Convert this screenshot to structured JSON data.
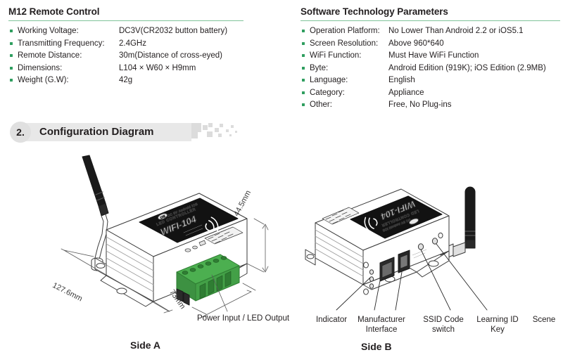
{
  "remote": {
    "title": "M12 Remote Control",
    "rows": [
      {
        "label": "Working Voltage:",
        "value": "DC3V(CR2032 button battery)"
      },
      {
        "label": "Transmitting Frequency:",
        "value": "2.4GHz"
      },
      {
        "label": "Remote Distance:",
        "value": "30m(Distance of cross-eyed)"
      },
      {
        "label": "Dimensions:",
        "value": "L104 × W60 × H9mm"
      },
      {
        "label": "Weight (G.W):",
        "value": "42g"
      }
    ]
  },
  "software": {
    "title": "Software Technology Parameters",
    "rows": [
      {
        "label": "Operation Platform:",
        "value": "No Lower Than Android 2.2 or iOS5.1"
      },
      {
        "label": "Screen Resolution:",
        "value": "Above 960*640"
      },
      {
        "label": "WiFi Function:",
        "value": "Must Have WiFi Function"
      },
      {
        "label": "Byte:",
        "value": "Android Edition (919K); iOS Edition (2.9MB)"
      },
      {
        "label": "Language:",
        "value": "English"
      },
      {
        "label": "Category:",
        "value": "Appliance"
      },
      {
        "label": "Other:",
        "value": "Free, No Plug-ins"
      }
    ]
  },
  "section": {
    "number": "2.",
    "title": "Configuration Diagram"
  },
  "side_a": {
    "caption": "Side A",
    "device_label_line1": "LED CONTROLLER",
    "device_label_line2": "WIFI-104",
    "device_label_sub": "DC 5V  Android  iOS",
    "dimensions": {
      "length": "127.6mm",
      "height": "44.5mm",
      "depth": "73mm"
    },
    "port_label": "Power Input / LED Output"
  },
  "side_b": {
    "caption": "Side B",
    "device_label_line1": "LED CONTROLLER",
    "device_label_line2": "WIFI-104",
    "callouts": [
      {
        "text": "Indicator"
      },
      {
        "text": "Manufacturer\nInterface"
      },
      {
        "text": "SSID Code\nswitch"
      },
      {
        "text": "Learning ID\nKey"
      },
      {
        "text": "Scene"
      }
    ]
  },
  "colors": {
    "accent_rule": "#7fc49a",
    "bullet": "#2f9e5f",
    "banner_bar": "#e8e8e8",
    "banner_circle": "#e0e0e0",
    "terminal_green": "#4caf50",
    "text": "#231f20"
  }
}
